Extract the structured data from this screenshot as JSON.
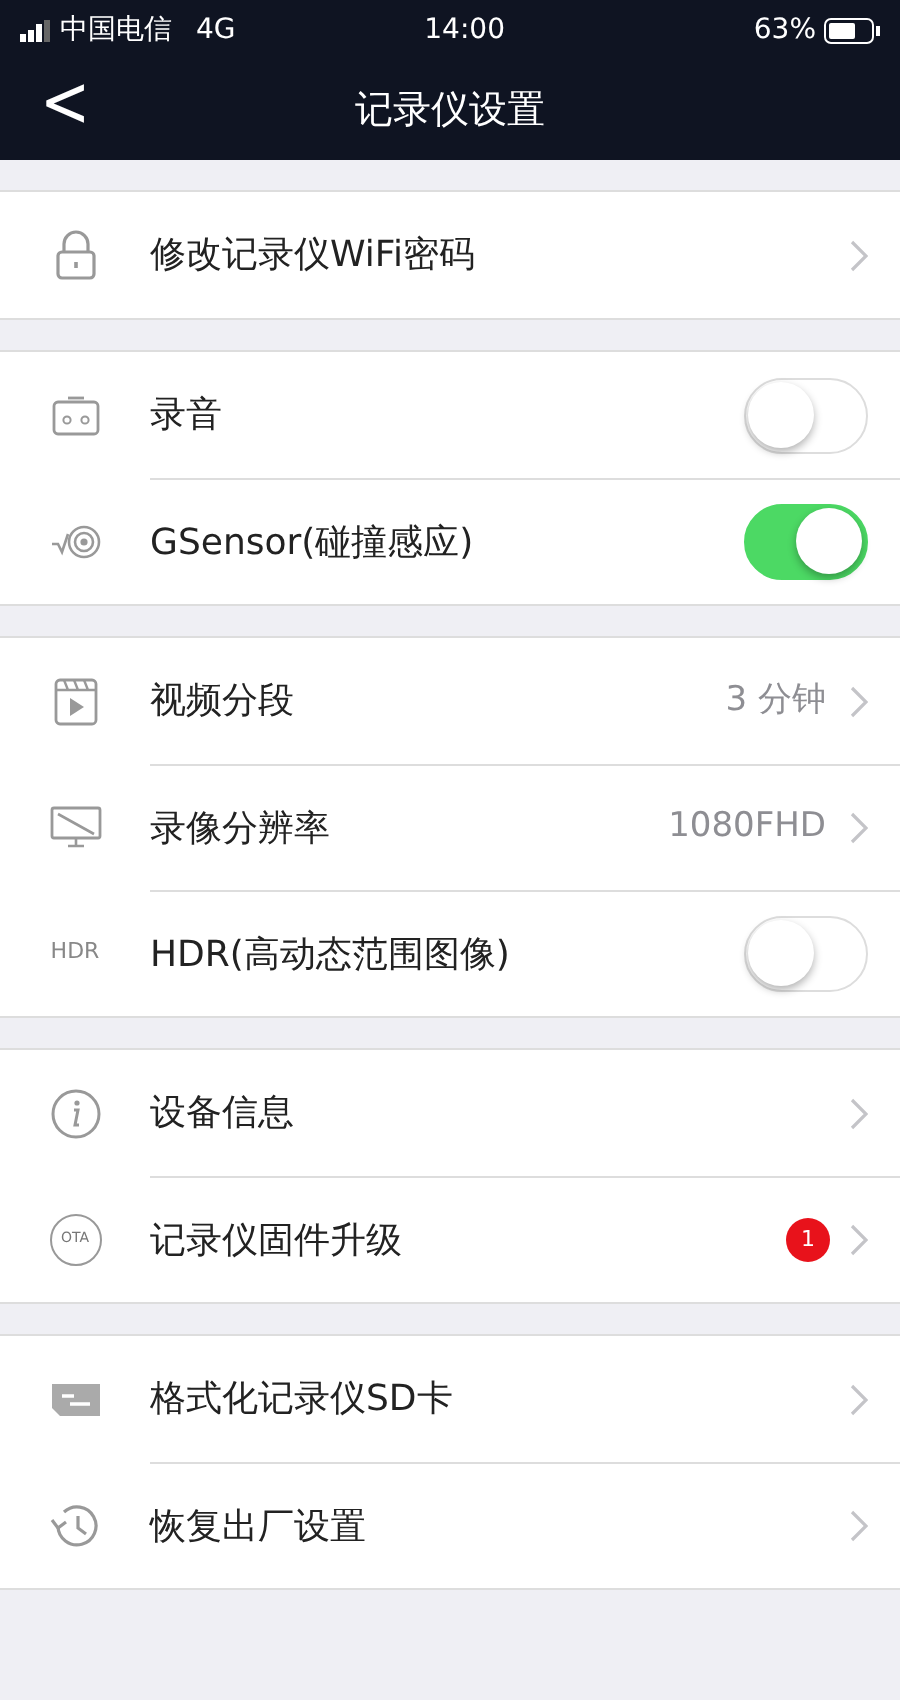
{
  "status_bar": {
    "carrier": "中国电信",
    "network": "4G",
    "time": "14:00",
    "battery": "63%"
  },
  "nav": {
    "back": "<",
    "title": "记录仪设置"
  },
  "groups": [
    {
      "items": [
        {
          "kind": "link",
          "label": "修改记录仪WiFi密码"
        }
      ]
    },
    {
      "items": [
        {
          "kind": "toggle",
          "label": "录音",
          "on": false
        },
        {
          "kind": "toggle",
          "label": "GSensor(碰撞感应)",
          "on": true
        }
      ]
    },
    {
      "items": [
        {
          "kind": "link",
          "label": "视频分段",
          "value": "3 分钟"
        },
        {
          "kind": "link",
          "label": "录像分辨率",
          "value": "1080FHD"
        },
        {
          "kind": "toggle",
          "label": "HDR(高动态范围图像)",
          "on": false,
          "icon_text": "HDR"
        }
      ]
    },
    {
      "items": [
        {
          "kind": "link",
          "label": "设备信息"
        },
        {
          "kind": "link",
          "label": "记录仪固件升级",
          "badge": "1",
          "icon_text": "OTA"
        }
      ]
    },
    {
      "items": [
        {
          "kind": "link",
          "label": "格式化记录仪SD卡"
        },
        {
          "kind": "link",
          "label": "恢复出厂设置"
        }
      ]
    }
  ]
}
